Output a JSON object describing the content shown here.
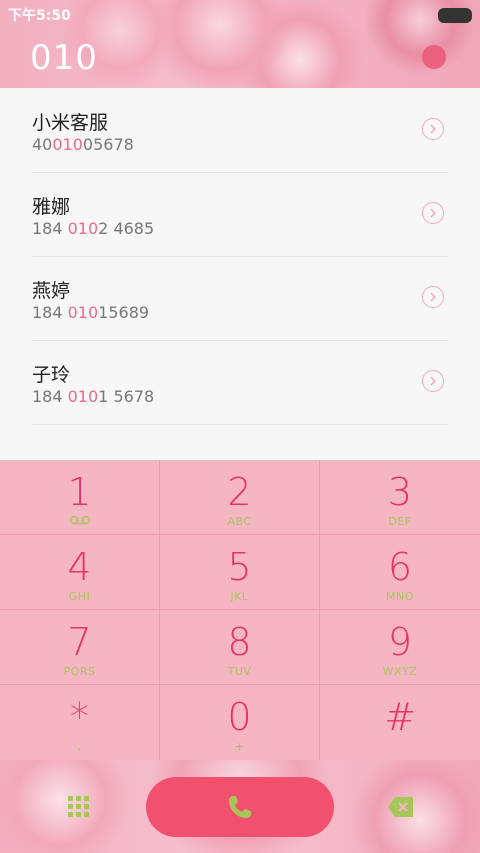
{
  "status": {
    "time": "下午5:50"
  },
  "dialer": {
    "number": "010"
  },
  "results": [
    {
      "name": "小米客服",
      "pre": "40",
      "hl": "010",
      "post": "05678"
    },
    {
      "name": "雅娜",
      "pre": "184 ",
      "hl": "010",
      "post": "2 4685"
    },
    {
      "name": "燕婷",
      "pre": "184 ",
      "hl": "010",
      "post": "15689"
    },
    {
      "name": "子玲",
      "pre": "184 ",
      "hl": "010",
      "post": "1 5678"
    }
  ],
  "keypad": [
    {
      "digit": "1",
      "letters": "⌂⌂"
    },
    {
      "digit": "2",
      "letters": "ABC"
    },
    {
      "digit": "3",
      "letters": "DEF"
    },
    {
      "digit": "4",
      "letters": "GHI"
    },
    {
      "digit": "5",
      "letters": "JKL"
    },
    {
      "digit": "6",
      "letters": "MNO"
    },
    {
      "digit": "7",
      "letters": "PQRS"
    },
    {
      "digit": "8",
      "letters": "TUV"
    },
    {
      "digit": "9",
      "letters": "WXYZ"
    },
    {
      "digit": "*",
      "letters": ","
    },
    {
      "digit": "0",
      "letters": "+"
    },
    {
      "digit": "#",
      "letters": ""
    }
  ],
  "colors": {
    "accent": "#e8306a",
    "call": "#f2506f",
    "letters": "#a6c65a",
    "highlight": "#f06a8a"
  },
  "icons": {
    "call": "phone-icon",
    "grid": "dialpad-icon",
    "delete": "backspace-icon",
    "more": "chevron-right-icon"
  }
}
